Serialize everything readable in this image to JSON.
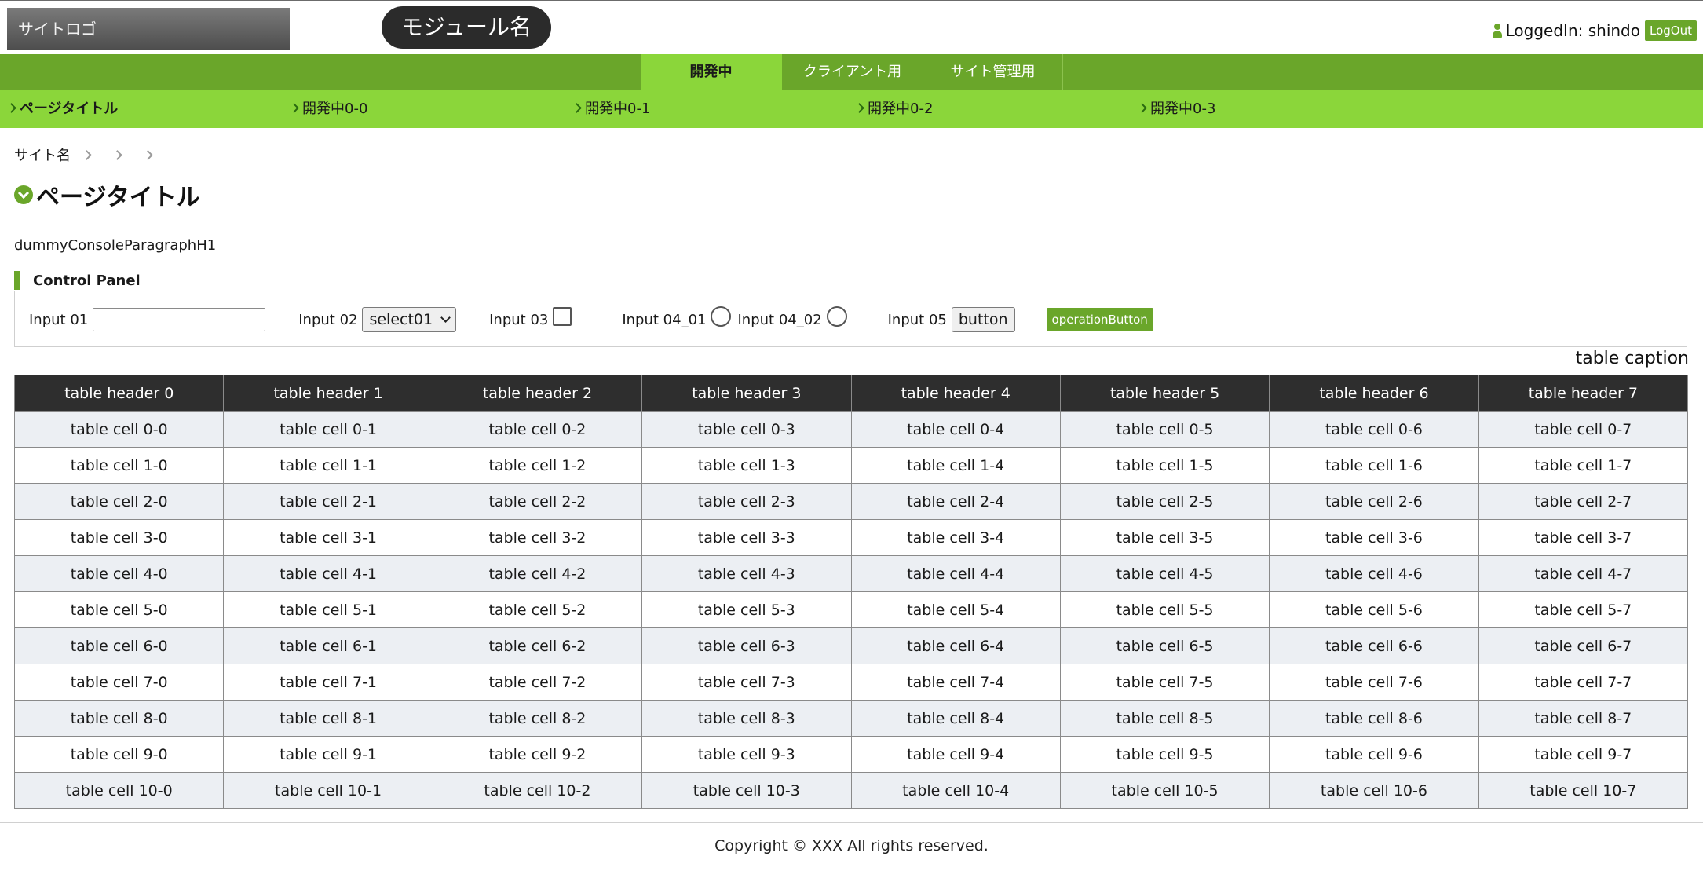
{
  "header": {
    "site_logo": "サイトロゴ",
    "module_name": "モジュール名",
    "logged_in_text": "LoggedIn: shindo",
    "logout_label": "LogOut"
  },
  "nav": {
    "tabs": [
      {
        "label": "開発中",
        "active": true
      },
      {
        "label": "クライアント用",
        "active": false
      },
      {
        "label": "サイト管理用",
        "active": false
      }
    ],
    "subnav": [
      {
        "label": "ページタイトル",
        "active": true
      },
      {
        "label": "開発中0-0",
        "active": false
      },
      {
        "label": "開発中0-1",
        "active": false
      },
      {
        "label": "開発中0-2",
        "active": false
      },
      {
        "label": "開発中0-3",
        "active": false
      }
    ]
  },
  "breadcrumb": {
    "site_name": "サイト名"
  },
  "page": {
    "title": "ページタイトル",
    "paragraph": "dummyConsoleParagraphH1"
  },
  "control_panel": {
    "title": "Control Panel",
    "input01_label": "Input 01",
    "input01_value": "",
    "input02_label": "Input 02",
    "input02_selected": "select01",
    "input03_label": "Input 03",
    "input04_01_label": "Input 04_01",
    "input04_02_label": "Input 04_02",
    "input05_label": "Input 05",
    "button_label": "button",
    "operation_button_label": "operationButton"
  },
  "table": {
    "caption": "table caption",
    "headers": [
      "table header 0",
      "table header 1",
      "table header 2",
      "table header 3",
      "table header 4",
      "table header 5",
      "table header 6",
      "table header 7"
    ],
    "rows": [
      [
        "table cell 0-0",
        "table cell 0-1",
        "table cell 0-2",
        "table cell 0-3",
        "table cell 0-4",
        "table cell 0-5",
        "table cell 0-6",
        "table cell 0-7"
      ],
      [
        "table cell 1-0",
        "table cell 1-1",
        "table cell 1-2",
        "table cell 1-3",
        "table cell 1-4",
        "table cell 1-5",
        "table cell 1-6",
        "table cell 1-7"
      ],
      [
        "table cell 2-0",
        "table cell 2-1",
        "table cell 2-2",
        "table cell 2-3",
        "table cell 2-4",
        "table cell 2-5",
        "table cell 2-6",
        "table cell 2-7"
      ],
      [
        "table cell 3-0",
        "table cell 3-1",
        "table cell 3-2",
        "table cell 3-3",
        "table cell 3-4",
        "table cell 3-5",
        "table cell 3-6",
        "table cell 3-7"
      ],
      [
        "table cell 4-0",
        "table cell 4-1",
        "table cell 4-2",
        "table cell 4-3",
        "table cell 4-4",
        "table cell 4-5",
        "table cell 4-6",
        "table cell 4-7"
      ],
      [
        "table cell 5-0",
        "table cell 5-1",
        "table cell 5-2",
        "table cell 5-3",
        "table cell 5-4",
        "table cell 5-5",
        "table cell 5-6",
        "table cell 5-7"
      ],
      [
        "table cell 6-0",
        "table cell 6-1",
        "table cell 6-2",
        "table cell 6-3",
        "table cell 6-4",
        "table cell 6-5",
        "table cell 6-6",
        "table cell 6-7"
      ],
      [
        "table cell 7-0",
        "table cell 7-1",
        "table cell 7-2",
        "table cell 7-3",
        "table cell 7-4",
        "table cell 7-5",
        "table cell 7-6",
        "table cell 7-7"
      ],
      [
        "table cell 8-0",
        "table cell 8-1",
        "table cell 8-2",
        "table cell 8-3",
        "table cell 8-4",
        "table cell 8-5",
        "table cell 8-6",
        "table cell 8-7"
      ],
      [
        "table cell 9-0",
        "table cell 9-1",
        "table cell 9-2",
        "table cell 9-3",
        "table cell 9-4",
        "table cell 9-5",
        "table cell 9-6",
        "table cell 9-7"
      ],
      [
        "table cell 10-0",
        "table cell 10-1",
        "table cell 10-2",
        "table cell 10-3",
        "table cell 10-4",
        "table cell 10-5",
        "table cell 10-6",
        "table cell 10-7"
      ]
    ]
  },
  "footer": {
    "copyright": "Copyright © XXX All rights reserved."
  },
  "colors": {
    "accent_dark": "#6aa62a",
    "accent_light": "#8bd63a",
    "header_dark": "#2e2e2e",
    "row_alt": "#eceff3"
  }
}
